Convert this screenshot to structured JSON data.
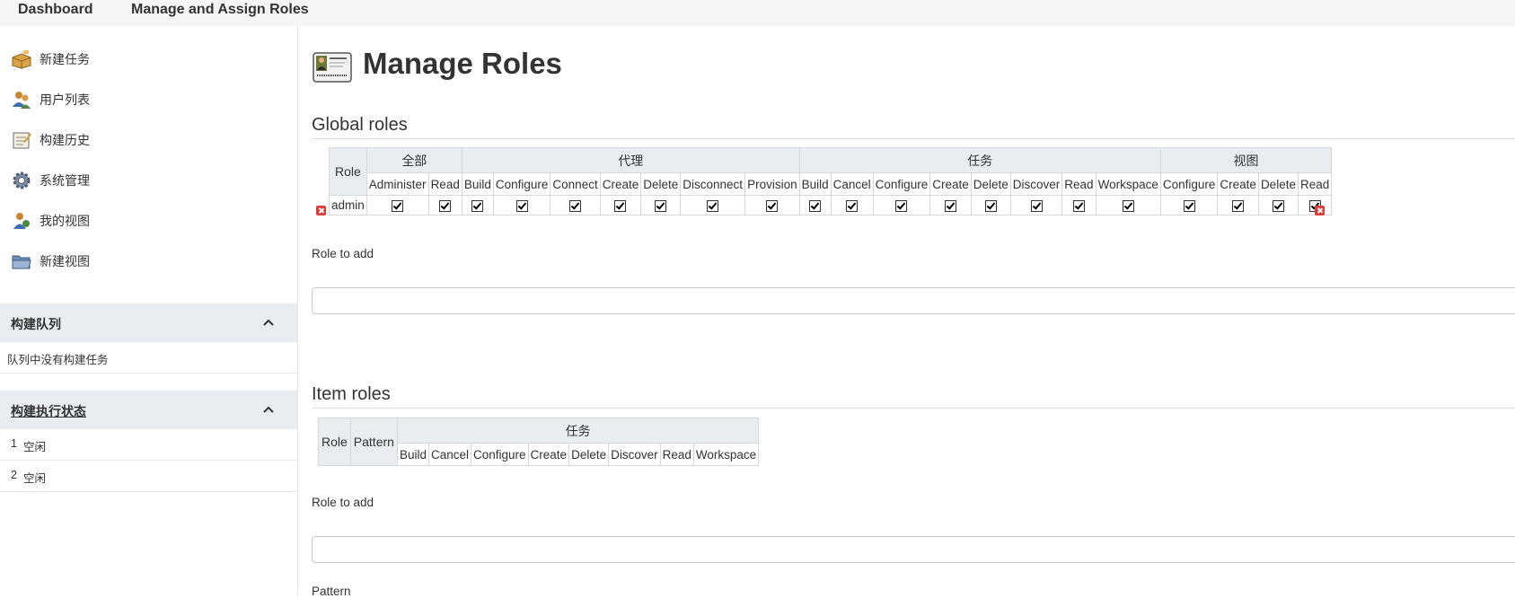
{
  "breadcrumbs": [
    "Dashboard",
    "Manage and Assign Roles"
  ],
  "sidebar": {
    "tasks": [
      {
        "label": "新建任务",
        "icon": "new-package-icon"
      },
      {
        "label": "用户列表",
        "icon": "users-icon"
      },
      {
        "label": "构建历史",
        "icon": "notepad-icon"
      },
      {
        "label": "系统管理",
        "icon": "gear-icon"
      },
      {
        "label": "我的视图",
        "icon": "user-view-icon"
      },
      {
        "label": "新建视图",
        "icon": "folder-icon"
      }
    ],
    "build_queue": {
      "title": "构建队列",
      "empty_text": "队列中没有构建任务"
    },
    "executors": {
      "title": "构建执行状态",
      "rows": [
        {
          "num": "1",
          "status": "空闲"
        },
        {
          "num": "2",
          "status": "空闲"
        }
      ]
    }
  },
  "main": {
    "title": "Manage Roles",
    "global_roles": {
      "heading": "Global roles",
      "role_header": "Role",
      "groups": [
        {
          "label": "全部",
          "perms": [
            "Administer",
            "Read"
          ]
        },
        {
          "label": "代理",
          "perms": [
            "Build",
            "Configure",
            "Connect",
            "Create",
            "Delete",
            "Disconnect",
            "Provision"
          ]
        },
        {
          "label": "任务",
          "perms": [
            "Build",
            "Cancel",
            "Configure",
            "Create",
            "Delete",
            "Discover",
            "Read",
            "Workspace"
          ]
        },
        {
          "label": "视图",
          "perms": [
            "Configure",
            "Create",
            "Delete",
            "Read"
          ]
        }
      ],
      "rows": [
        {
          "role": "admin",
          "checked": true
        }
      ],
      "role_to_add_label": "Role to add",
      "role_to_add_value": ""
    },
    "item_roles": {
      "heading": "Item roles",
      "role_header": "Role",
      "pattern_header": "Pattern",
      "groups": [
        {
          "label": "任务",
          "perms": [
            "Build",
            "Cancel",
            "Configure",
            "Create",
            "Delete",
            "Discover",
            "Read",
            "Workspace"
          ]
        }
      ],
      "role_to_add_label": "Role to add",
      "role_to_add_value": "",
      "pattern_label": "Pattern"
    }
  },
  "colors": {
    "topbar_bg": "#f6f6f6",
    "pane_header_bg": "#eaedf0",
    "table_header_bg": "#e9edf0",
    "delete_red": "#e03a3a"
  }
}
